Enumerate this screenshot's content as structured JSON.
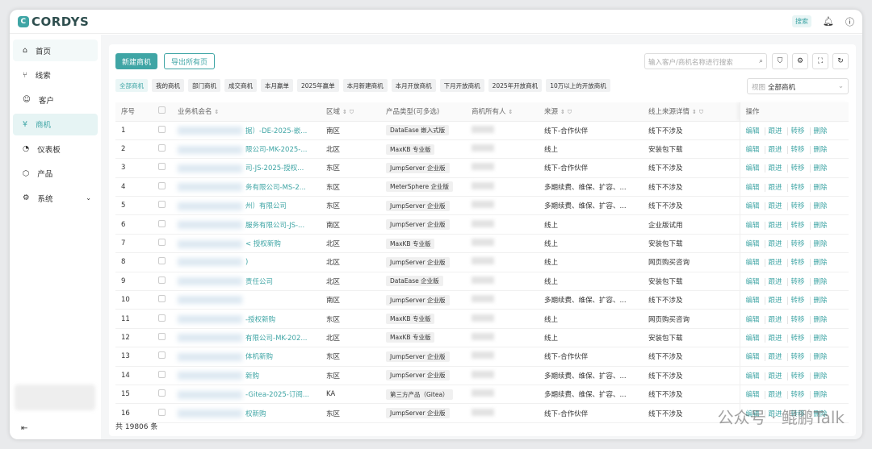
{
  "app": {
    "logo": "CORDYS",
    "search_label": "搜索"
  },
  "sidebar": {
    "items": [
      {
        "label": "首页",
        "icon": "home-icon"
      },
      {
        "label": "线索",
        "icon": "leads-icon"
      },
      {
        "label": "客户",
        "icon": "customer-icon"
      },
      {
        "label": "商机",
        "icon": "opportunity-icon"
      },
      {
        "label": "仪表板",
        "icon": "dashboard-icon"
      },
      {
        "label": "产品",
        "icon": "product-icon"
      },
      {
        "label": "系统",
        "icon": "gear-icon"
      }
    ]
  },
  "toolbar": {
    "new_label": "新建商机",
    "export_label": "导出所有页",
    "search_placeholder": "输入客户/商机名称进行搜索"
  },
  "tabs": [
    "全部商机",
    "我的商机",
    "部门商机",
    "成交商机",
    "本月赢单",
    "2025年赢单",
    "本月新建商机",
    "本月开放商机",
    "下月开放商机",
    "2025年开放商机",
    "10万以上的开放商机"
  ],
  "view": {
    "label": "视图",
    "value": "全部商机"
  },
  "table": {
    "headers": [
      "序号",
      "业务机会名",
      "区域",
      "产品类型(可多选)",
      "商机所有人",
      "来源",
      "线上来源详情",
      "操作"
    ],
    "actions": [
      "编辑",
      "跟进",
      "转移",
      "删除"
    ],
    "rows": [
      {
        "no": "1",
        "name": "据）-DE-2025-嵌...",
        "region": "南区",
        "product": "DataEase 嵌入式版",
        "source": "线下-合作伙伴",
        "detail": "线下不涉及"
      },
      {
        "no": "2",
        "name": "限公司-MK-2025-...",
        "region": "北区",
        "product": "MaxKB 专业版",
        "source": "线上",
        "detail": "安装包下载"
      },
      {
        "no": "3",
        "name": "司-JS-2025-授权...",
        "region": "东区",
        "product": "JumpServer 企业版",
        "source": "线下-合作伙伴",
        "detail": "线下不涉及"
      },
      {
        "no": "4",
        "name": "务有限公司-MS-2...",
        "region": "东区",
        "product": "MeterSphere 企业版",
        "source": "多期续费、维保、扩容、...",
        "detail": "线下不涉及"
      },
      {
        "no": "5",
        "name": "州）有限公司",
        "region": "东区",
        "product": "JumpServer 企业版",
        "source": "多期续费、维保、扩容、...",
        "detail": "线下不涉及"
      },
      {
        "no": "6",
        "name": "服务有限公司-JS-...",
        "region": "南区",
        "product": "JumpServer 企业版",
        "source": "线上",
        "detail": "企业版试用"
      },
      {
        "no": "7",
        "name": "< 授权新购",
        "region": "北区",
        "product": "MaxKB 专业版",
        "source": "线上",
        "detail": "安装包下载"
      },
      {
        "no": "8",
        "name": ")",
        "region": "北区",
        "product": "JumpServer 企业版",
        "source": "线上",
        "detail": "网页购买咨询"
      },
      {
        "no": "9",
        "name": "责任公司",
        "region": "北区",
        "product": "DataEase 企业版",
        "source": "线上",
        "detail": "安装包下载"
      },
      {
        "no": "10",
        "name": "",
        "region": "南区",
        "product": "JumpServer 企业版",
        "source": "多期续费、维保、扩容、...",
        "detail": "线下不涉及"
      },
      {
        "no": "11",
        "name": "-授权新购",
        "region": "东区",
        "product": "MaxKB 专业版",
        "source": "线上",
        "detail": "网页购买咨询"
      },
      {
        "no": "12",
        "name": "有限公司-MK-202...",
        "region": "北区",
        "product": "MaxKB 专业版",
        "source": "线上",
        "detail": "安装包下载"
      },
      {
        "no": "13",
        "name": "体机新购",
        "region": "东区",
        "product": "JumpServer 企业版",
        "source": "线下-合作伙伴",
        "detail": "线下不涉及"
      },
      {
        "no": "14",
        "name": "新购",
        "region": "东区",
        "product": "JumpServer 企业版",
        "source": "多期续费、维保、扩容、...",
        "detail": "线下不涉及"
      },
      {
        "no": "15",
        "name": "-Gitea-2025-订阅...",
        "region": "KA",
        "product": "第三方产品（Gitea）",
        "source": "多期续费、维保、扩容、...",
        "detail": "线下不涉及"
      },
      {
        "no": "16",
        "name": "权新购",
        "region": "东区",
        "product": "JumpServer 企业版",
        "source": "线下-合作伙伴",
        "detail": "线下不涉及"
      }
    ]
  },
  "footer": {
    "total": "共 19806 条"
  },
  "watermark": "公众号 · 鲲鹏Talk",
  "colors": {
    "accent": "#3fa5a5"
  }
}
